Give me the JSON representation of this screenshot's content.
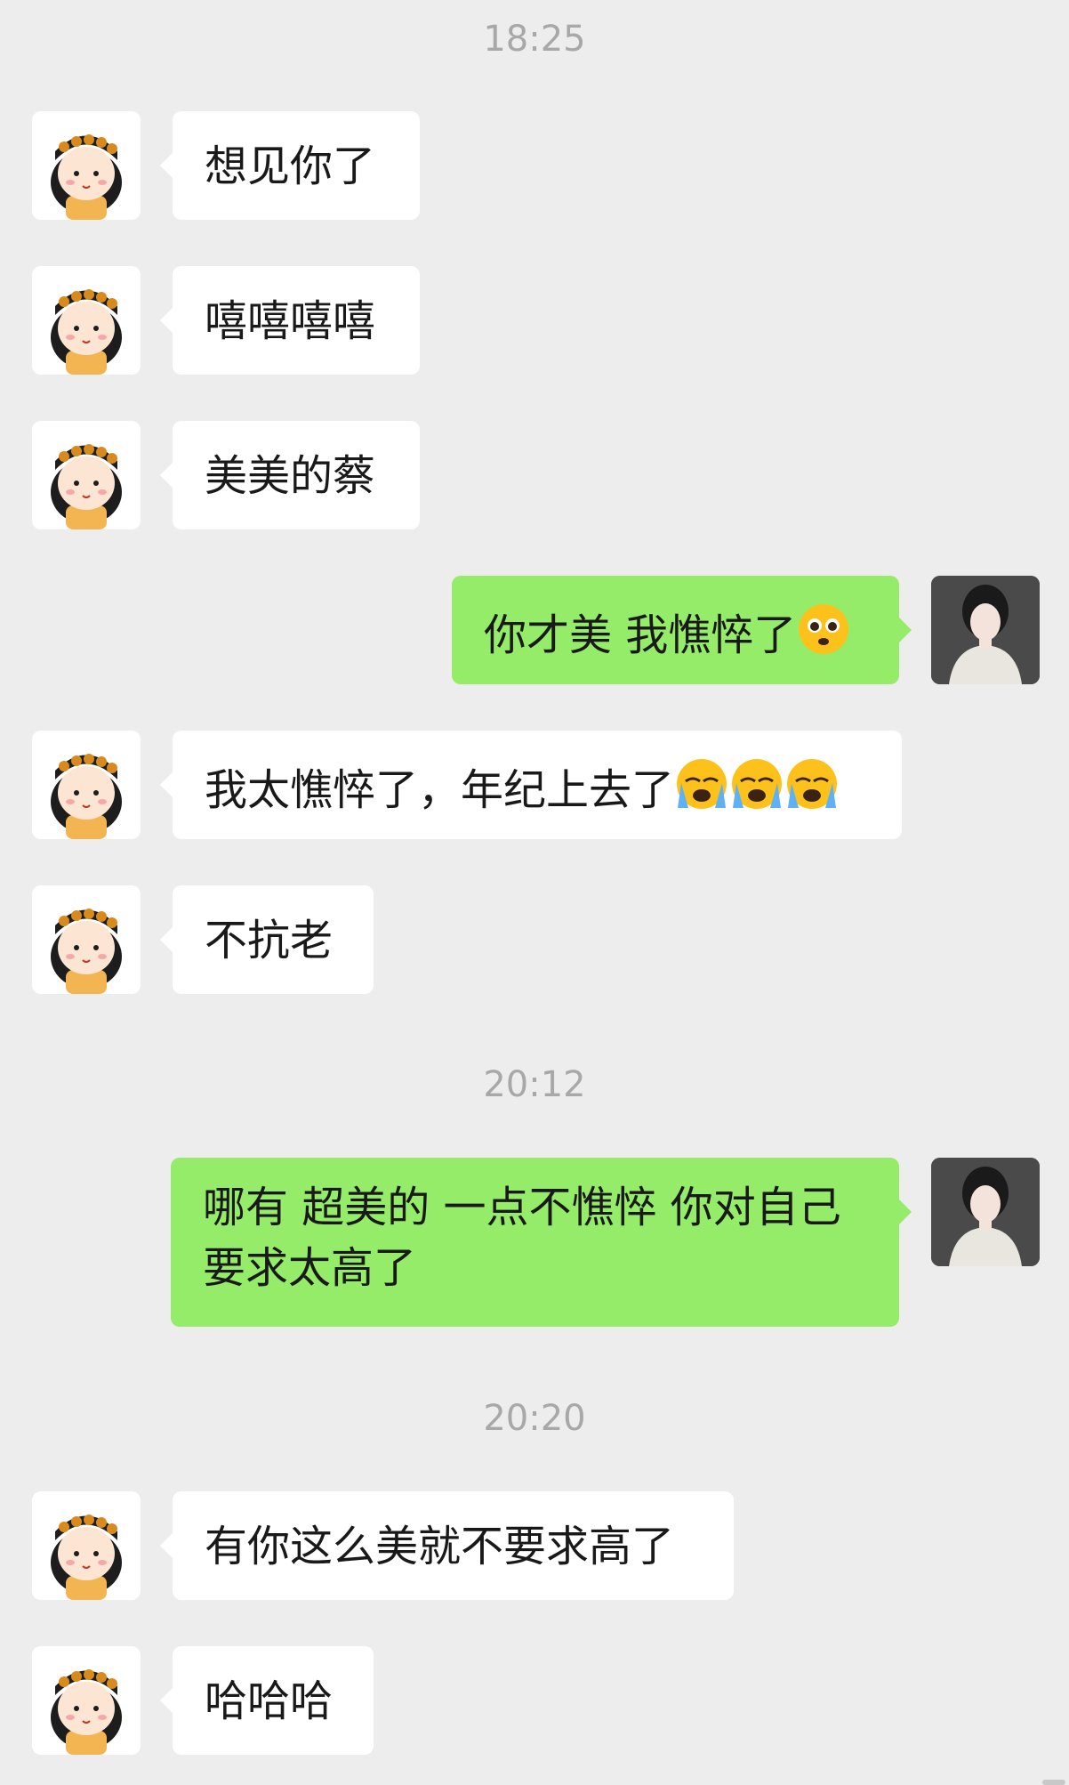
{
  "timestamps": [
    "18:25",
    "20:12",
    "20:20"
  ],
  "messages": [
    {
      "side": "in",
      "text": "想见你了"
    },
    {
      "side": "in",
      "text": "嘻嘻嘻嘻"
    },
    {
      "side": "in",
      "text": "美美的蔡"
    },
    {
      "side": "out",
      "text": "你才美 我憔悴了",
      "emoji": "pleading-face"
    },
    {
      "side": "in",
      "text": "我太憔悴了，年纪上去了",
      "emoji": "loudly-crying-face x3"
    },
    {
      "side": "in",
      "text": "不抗老"
    },
    {
      "side": "out",
      "text": "哪有 超美的 一点不憔悴 你对自己要求太高了"
    },
    {
      "side": "in",
      "text": "有你这么美就不要求高了"
    },
    {
      "side": "in",
      "text": "哈哈哈"
    }
  ],
  "colors": {
    "background": "#ededed",
    "incoming_bubble": "#ffffff",
    "outgoing_bubble": "#95ec69",
    "timestamp": "#a8a8a8",
    "text": "#191919"
  }
}
